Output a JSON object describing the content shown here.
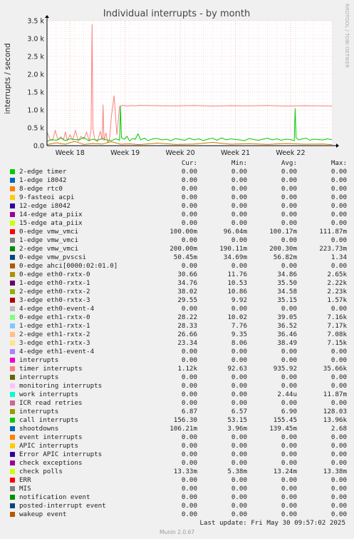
{
  "chart_data": {
    "type": "line",
    "title": "Individual interrupts - by month",
    "ylabel": "interrupts / second",
    "ylim": [
      0,
      3500
    ],
    "y_ticks": [
      0,
      500,
      1000,
      1500,
      2000,
      2500,
      3000,
      3500
    ],
    "y_tick_labels": [
      "0.0",
      "0.5 k",
      "1.0 k",
      "1.5 k",
      "2.0 k",
      "2.5 k",
      "3.0 k",
      "3.5 k"
    ],
    "x_tick_labels": [
      "Week 18",
      "Week 19",
      "Week 20",
      "Week 21",
      "Week 22"
    ],
    "xlim": [
      0,
      31
    ],
    "x_tick_positions": [
      2.5,
      8.5,
      14.5,
      20.5,
      26.5
    ],
    "side_text": "RRDTOOL / TOBI OETIKER",
    "grid": true,
    "series": [
      {
        "name": "timer interrupts",
        "color": "#ff7f7f",
        "x": [
          0,
          0.3,
          0.6,
          0.9,
          1.2,
          1.5,
          1.8,
          2.0,
          2.2,
          2.5,
          2.8,
          3.1,
          3.4,
          3.7,
          4.0,
          4.3,
          4.6,
          4.8,
          4.9,
          5.0,
          5.2,
          5.5,
          5.8,
          6.0,
          6.1,
          6.2,
          6.4,
          6.6,
          6.8,
          7.0,
          7.3,
          7.6,
          7.9,
          8.2,
          8.5,
          8.8,
          9.1,
          9.4,
          9.7,
          10.0,
          12,
          14,
          16,
          18,
          20,
          22,
          24,
          26,
          28,
          30,
          31
        ],
        "y": [
          380,
          190,
          140,
          420,
          160,
          250,
          160,
          390,
          140,
          300,
          160,
          420,
          130,
          260,
          180,
          380,
          120,
          450,
          3400,
          480,
          160,
          120,
          400,
          160,
          1150,
          130,
          360,
          90,
          150,
          800,
          1400,
          300,
          1100,
          1130,
          1120,
          1110,
          1125,
          1120,
          1115,
          1130,
          1120,
          1115,
          1125,
          1110,
          1120,
          1115,
          1125,
          1110,
          1120,
          1115,
          1110
        ]
      },
      {
        "name": "call interrupts",
        "color": "#00cc00",
        "x": [
          0,
          0.5,
          1,
          1.5,
          2,
          2.5,
          3,
          3.5,
          4,
          4.5,
          5,
          5.5,
          6,
          6.5,
          7,
          7.5,
          7.9,
          8.0,
          8.1,
          8.4,
          8.7,
          9.0,
          9.3,
          9.6,
          9.9,
          10.2,
          10.6,
          11,
          11.5,
          12,
          12.5,
          13,
          13.5,
          14,
          14.5,
          15,
          15.5,
          16,
          16.5,
          17,
          17.5,
          18,
          18.5,
          19,
          19.5,
          20,
          20.5,
          21,
          21.5,
          22,
          22.5,
          23,
          23.5,
          24,
          24.5,
          25,
          25.5,
          26,
          26.5,
          26.9,
          27.0,
          27.1,
          27.4,
          27.8,
          28.2,
          28.6,
          29,
          29.5,
          30,
          30.5,
          31
        ],
        "y": [
          120,
          170,
          150,
          210,
          140,
          190,
          170,
          160,
          230,
          140,
          180,
          150,
          200,
          160,
          140,
          190,
          150,
          1100,
          220,
          180,
          260,
          130,
          200,
          180,
          330,
          160,
          210,
          140,
          190,
          200,
          160,
          180,
          140,
          200,
          170,
          150,
          210,
          160,
          190,
          140,
          180,
          210,
          150,
          220,
          160,
          190,
          170,
          160,
          140,
          200,
          170,
          150,
          180,
          210,
          160,
          190,
          150,
          180,
          170,
          140,
          1050,
          220,
          160,
          190,
          210,
          150,
          180,
          170,
          160,
          190,
          170
        ]
      },
      {
        "name": "shootdowns",
        "color": "#0066b3",
        "x": [
          0,
          5,
          10,
          15,
          20,
          25,
          31
        ],
        "y": [
          0.12,
          0.1,
          0.15,
          0.13,
          0.11,
          0.14,
          0.12
        ]
      },
      {
        "name": "eth0-rxtx-0",
        "color": "#cc7300",
        "x": [
          0,
          1,
          2,
          3,
          4,
          5,
          6,
          7,
          8,
          9,
          10,
          12,
          14,
          16,
          18,
          20,
          22,
          24,
          26,
          28,
          30,
          31
        ],
        "y": [
          30,
          80,
          40,
          120,
          35,
          60,
          45,
          110,
          40,
          50,
          30,
          70,
          35,
          45,
          90,
          40,
          55,
          35,
          60,
          40,
          45,
          30
        ]
      }
    ]
  },
  "legend": {
    "headers": {
      "cur": "Cur:",
      "min": "Min:",
      "avg": "Avg:",
      "max": "Max:"
    },
    "rows": [
      {
        "color": "#00cc00",
        "name": "2-edge timer",
        "cur": "0.00",
        "min": "0.00",
        "avg": "0.00",
        "max": "0.00"
      },
      {
        "color": "#0066b3",
        "name": "1-edge i8042",
        "cur": "0.00",
        "min": "0.00",
        "avg": "0.00",
        "max": "0.00"
      },
      {
        "color": "#ff8000",
        "name": "8-edge rtc0",
        "cur": "0.00",
        "min": "0.00",
        "avg": "0.00",
        "max": "0.00"
      },
      {
        "color": "#ffcc00",
        "name": "9-fasteoi acpi",
        "cur": "0.00",
        "min": "0.00",
        "avg": "0.00",
        "max": "0.00"
      },
      {
        "color": "#330099",
        "name": "12-edge i8042",
        "cur": "0.00",
        "min": "0.00",
        "avg": "0.00",
        "max": "0.00"
      },
      {
        "color": "#990099",
        "name": "14-edge ata_piix",
        "cur": "0.00",
        "min": "0.00",
        "avg": "0.00",
        "max": "0.00"
      },
      {
        "color": "#ccff00",
        "name": "15-edge ata_piix",
        "cur": "0.00",
        "min": "0.00",
        "avg": "0.00",
        "max": "0.00"
      },
      {
        "color": "#ff0000",
        "name": "0-edge vmw_vmci",
        "cur": "100.00m",
        "min": "96.04m",
        "avg": "100.17m",
        "max": "111.87m"
      },
      {
        "color": "#808080",
        "name": "1-edge vmw_vmci",
        "cur": "0.00",
        "min": "0.00",
        "avg": "0.00",
        "max": "0.00"
      },
      {
        "color": "#008f00",
        "name": "2-edge vmw_vmci",
        "cur": "200.00m",
        "min": "190.11m",
        "avg": "200.30m",
        "max": "223.73m"
      },
      {
        "color": "#00487d",
        "name": "0-edge vmw_pvscsi",
        "cur": "50.45m",
        "min": "34.69m",
        "avg": "56.82m",
        "max": "1.34"
      },
      {
        "color": "#b35a00",
        "name": "0-edge ahci[0000:02:01.0]",
        "cur": "0.00",
        "min": "0.00",
        "avg": "0.00",
        "max": "0.00"
      },
      {
        "color": "#b38f00",
        "name": "0-edge eth0-rxtx-0",
        "cur": "30.66",
        "min": "11.76",
        "avg": "34.86",
        "max": "2.65k"
      },
      {
        "color": "#6b006b",
        "name": "1-edge eth0-rxtx-1",
        "cur": "34.76",
        "min": "10.53",
        "avg": "35.50",
        "max": "2.22k"
      },
      {
        "color": "#8fb300",
        "name": "2-edge eth0-rxtx-2",
        "cur": "38.02",
        "min": "10.86",
        "avg": "34.58",
        "max": "2.23k"
      },
      {
        "color": "#b30000",
        "name": "3-edge eth0-rxtx-3",
        "cur": "29.55",
        "min": "9.92",
        "avg": "35.15",
        "max": "1.57k"
      },
      {
        "color": "#bebebe",
        "name": "4-edge eth0-event-4",
        "cur": "0.00",
        "min": "0.00",
        "avg": "0.00",
        "max": "0.00"
      },
      {
        "color": "#80ff80",
        "name": "0-edge eth1-rxtx-0",
        "cur": "28.22",
        "min": "10.02",
        "avg": "39.05",
        "max": "7.16k"
      },
      {
        "color": "#80c9ff",
        "name": "1-edge eth1-rxtx-1",
        "cur": "28.33",
        "min": "7.76",
        "avg": "36.52",
        "max": "7.17k"
      },
      {
        "color": "#ffc080",
        "name": "2-edge eth1-rxtx-2",
        "cur": "26.66",
        "min": "9.35",
        "avg": "36.46",
        "max": "7.08k"
      },
      {
        "color": "#ffe680",
        "name": "3-edge eth1-rxtx-3",
        "cur": "23.34",
        "min": "8.06",
        "avg": "38.49",
        "max": "7.15k"
      },
      {
        "color": "#aa80ff",
        "name": "4-edge eth1-event-4",
        "cur": "0.00",
        "min": "0.00",
        "avg": "0.00",
        "max": "0.00"
      },
      {
        "color": "#ee00cc",
        "name": "interrupts",
        "cur": "0.00",
        "min": "0.00",
        "avg": "0.00",
        "max": "0.00"
      },
      {
        "color": "#ff8080",
        "name": "timer interrupts",
        "cur": "1.12k",
        "min": "92.63",
        "avg": "935.92",
        "max": "35.66k"
      },
      {
        "color": "#666600",
        "name": "interrupts",
        "cur": "0.00",
        "min": "0.00",
        "avg": "0.00",
        "max": "0.00"
      },
      {
        "color": "#ffbfff",
        "name": "monitoring interrupts",
        "cur": "0.00",
        "min": "0.00",
        "avg": "0.00",
        "max": "0.00"
      },
      {
        "color": "#00ffcc",
        "name": "work interrupts",
        "cur": "0.00",
        "min": "0.00",
        "avg": "2.44u",
        "max": "11.87m"
      },
      {
        "color": "#cc6699",
        "name": "ICR read retries",
        "cur": "0.00",
        "min": "0.00",
        "avg": "0.00",
        "max": "0.00"
      },
      {
        "color": "#999900",
        "name": "interrupts",
        "cur": "6.87",
        "min": "6.57",
        "avg": "6.90",
        "max": "128.03"
      },
      {
        "color": "#00cc00",
        "name": "call interrupts",
        "cur": "156.30",
        "min": "53.15",
        "avg": "155.45",
        "max": "13.96k"
      },
      {
        "color": "#0066b3",
        "name": "shootdowns",
        "cur": "106.21m",
        "min": "3.96m",
        "avg": "139.45m",
        "max": "2.68"
      },
      {
        "color": "#ff8000",
        "name": "event interrupts",
        "cur": "0.00",
        "min": "0.00",
        "avg": "0.00",
        "max": "0.00"
      },
      {
        "color": "#ffcc00",
        "name": "APIC interrupts",
        "cur": "0.00",
        "min": "0.00",
        "avg": "0.00",
        "max": "0.00"
      },
      {
        "color": "#330099",
        "name": "Error APIC interrupts",
        "cur": "0.00",
        "min": "0.00",
        "avg": "0.00",
        "max": "0.00"
      },
      {
        "color": "#990099",
        "name": "check exceptions",
        "cur": "0.00",
        "min": "0.00",
        "avg": "0.00",
        "max": "0.00"
      },
      {
        "color": "#ccff00",
        "name": "check polls",
        "cur": "13.33m",
        "min": "5.38m",
        "avg": "13.24m",
        "max": "13.38m"
      },
      {
        "color": "#ff0000",
        "name": "ERR",
        "cur": "0.00",
        "min": "0.00",
        "avg": "0.00",
        "max": "0.00"
      },
      {
        "color": "#808080",
        "name": "MIS",
        "cur": "0.00",
        "min": "0.00",
        "avg": "0.00",
        "max": "0.00"
      },
      {
        "color": "#008f00",
        "name": "notification event",
        "cur": "0.00",
        "min": "0.00",
        "avg": "0.00",
        "max": "0.00"
      },
      {
        "color": "#00487d",
        "name": "posted-interrupt event",
        "cur": "0.00",
        "min": "0.00",
        "avg": "0.00",
        "max": "0.00"
      },
      {
        "color": "#b35a00",
        "name": "wakeup event",
        "cur": "0.00",
        "min": "0.00",
        "avg": "0.00",
        "max": "0.00"
      }
    ]
  },
  "footer": {
    "last_update": "Last update: Fri May 30 09:57:02 2025",
    "munin": "Munin 2.0.67"
  }
}
